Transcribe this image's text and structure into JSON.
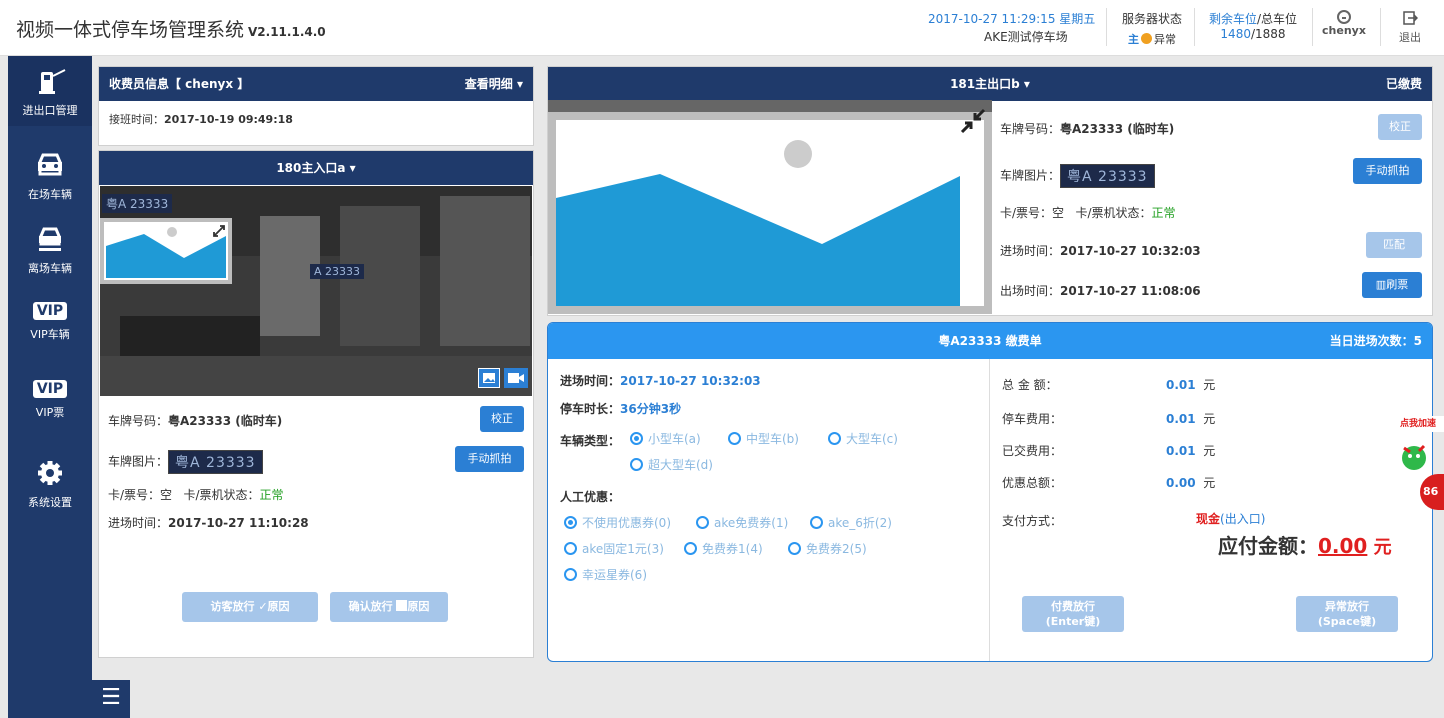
{
  "app": {
    "title": "视频一体式停车场管理系统",
    "version": "V2.11.1.4.0"
  },
  "topbar": {
    "datetime": "2017-10-27 11:29:15 星期五",
    "lot_name": "AKE测试停车场",
    "server_label": "服务器状态",
    "server_main": "主",
    "server_status": "异常",
    "space_label_remaining": "剩余车位",
    "space_label_total": "/总车位",
    "space_value_remaining": "1480",
    "space_value_total": "/1888",
    "user": "chenyx",
    "exit": "退出"
  },
  "sidebar": {
    "items": [
      {
        "label": "进出口管理",
        "icon": "gate-barrier-icon"
      },
      {
        "label": "在场车辆",
        "icon": "car-front-icon"
      },
      {
        "label": "离场车辆",
        "icon": "car-exit-icon"
      },
      {
        "label": "VIP车辆",
        "icon": "vip-icon"
      },
      {
        "label": "VIP票",
        "icon": "vip-ticket-icon"
      },
      {
        "label": "系统设置",
        "icon": "gear-icon"
      }
    ],
    "vip_text": "VIP",
    "menu": "☰"
  },
  "collector": {
    "title": "收费员信息【 chenyx 】",
    "details": "查看明细 ▾",
    "shift_label": "接班时间：",
    "shift_time": "2017-10-19 09:49:18"
  },
  "entrance": {
    "title": "180主入口a ▾",
    "plate_label": "车牌号码：",
    "plate_value": "粤A23333 (临时车)",
    "plate_img_label": "车牌图片：",
    "plate_img_text": "粤A 23333",
    "card_label": "卡/票号：空",
    "card_status_label": "卡/票机状态：",
    "card_status": "正常",
    "entry_label": "进场时间：",
    "entry_time": "2017-10-27 11:10:28",
    "correct_btn": "校正",
    "capture_btn": "手动抓拍",
    "visitor_btn": "访客放行",
    "confirm_btn": "确认放行",
    "reason": "原因",
    "cam_plate_text": "粤A 23333",
    "cam_plate_text2": "A 23333"
  },
  "exit": {
    "title": "181主出口b ▾",
    "paid": "已缴费",
    "plate_label": "车牌号码：",
    "plate_value": "粤A23333 (临时车)",
    "plate_img_label": "车牌图片：",
    "plate_img_text": "粤A 23333",
    "card_label": "卡/票号：空",
    "card_status_label": "卡/票机状态：",
    "card_status": "正常",
    "entry_label": "进场时间：",
    "entry_time": "2017-10-27 10:32:03",
    "exit_label": "出场时间：",
    "exit_time": "2017-10-27 11:08:06",
    "correct_btn": "校正",
    "capture_btn": "手动抓拍",
    "match_btn": "匹配",
    "ticket_btn": "▥刷票"
  },
  "payment": {
    "title": "粤A23333  缴费单",
    "count_label": "当日进场次数：5",
    "entry_label": "进场时间：",
    "entry_time": "2017-10-27 10:32:03",
    "duration_label": "停车时长：",
    "duration": "36分钟3秒",
    "type_label": "车辆类型：",
    "types": [
      "小型车(a)",
      "中型车(b)",
      "大型车(c)",
      "超大型车(d)"
    ],
    "discount_label": "人工优惠：",
    "discounts": [
      "不使用优惠券(0)",
      "ake免费券(1)",
      "ake_6折(2)",
      "ake固定1元(3)",
      "免费券1(4)",
      "免费券2(5)",
      "幸运星券(6)"
    ],
    "total_label": "总 金 额：",
    "total": "0.01",
    "fee_label": "停车费用：",
    "fee": "0.01",
    "paid_label": "已交费用：",
    "paid": "0.01",
    "discount_total_label": "优惠总额：",
    "discount_total": "0.00",
    "unit": "元",
    "method_label": "支付方式：",
    "method": "现金",
    "method_note": "(出入口)",
    "due_label": "应付金额：",
    "due": "0.00",
    "pay_btn_line1": "付费放行",
    "pay_btn_line2": "(Enter键)",
    "abn_btn_line1": "异常放行",
    "abn_btn_line2": "(Space键)"
  },
  "promo": {
    "text": "点我加速",
    "badge": "86"
  },
  "colors": {
    "navy": "#1f3a6b",
    "blue": "#2b7fd4",
    "payHeader": "#2b96f0",
    "red": "#e02020",
    "green": "#22a022"
  }
}
